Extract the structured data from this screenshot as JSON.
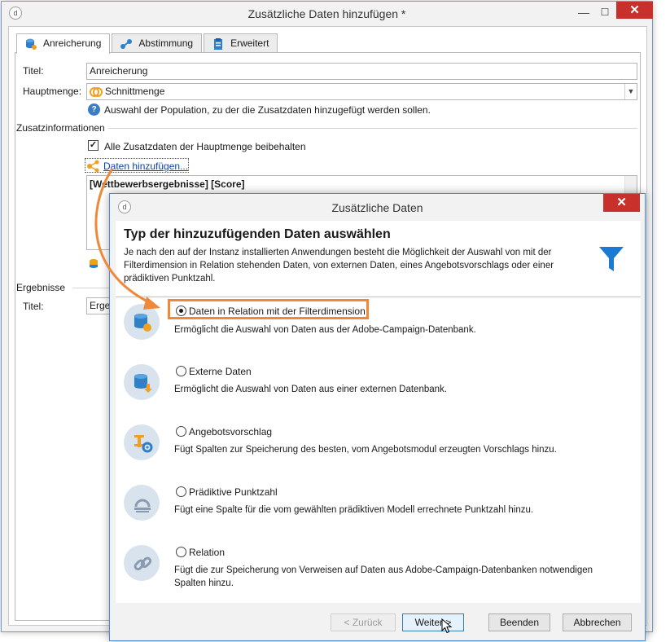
{
  "outer_window": {
    "title": "Zusätzliche Daten hinzufügen *",
    "tabs": [
      {
        "label": "Anreicherung",
        "icon": "database-enrich-icon"
      },
      {
        "label": "Abstimmung",
        "icon": "link-nodes-icon"
      },
      {
        "label": "Erweitert",
        "icon": "clipboard-icon"
      }
    ],
    "title_label": "Titel:",
    "title_value": "Anreicherung",
    "hauptmenge_label": "Hauptmenge:",
    "hauptmenge_value": "Schnittmenge",
    "help_text": "Auswahl der Population, zu der die Zusatzdaten hinzugefügt werden sollen.",
    "zusatz_group": "Zusatzinformationen",
    "keep_checkbox_label": "Alle Zusatzdaten der Hauptmenge beibehalten",
    "keep_checked": true,
    "add_data_link": "Daten hinzufügen...",
    "list_item": "[Wettbewerbsergebnisse] [Score]",
    "ergebnisse_group": "Ergebnisse",
    "result_title_label": "Titel:",
    "result_title_value": "Ergeb"
  },
  "dialog": {
    "title": "Zusätzliche Daten",
    "heading": "Typ der hinzuzufügenden Daten auswählen",
    "description": "Je nach den auf der Instanz installierten Anwendungen besteht die Möglichkeit der Auswahl von mit der Filterdimension in Relation stehenden Daten, von externen Daten, eines Angebotsvorschlags oder einer prädiktiven Punktzahl.",
    "options": [
      {
        "label": "Daten in Relation mit der Filterdimension",
        "desc": "Ermöglicht die Auswahl von Daten aus der Adobe-Campaign-Datenbank.",
        "selected": true,
        "icon": "database-filter-icon"
      },
      {
        "label": "Externe Daten",
        "desc": "Ermöglicht die Auswahl von Daten aus einer externen Datenbank.",
        "selected": false,
        "icon": "external-database-icon"
      },
      {
        "label": "Angebotsvorschlag",
        "desc": "Fügt Spalten zur Speicherung des besten, vom Angebotsmodul erzeugten Vorschlags hinzu.",
        "selected": false,
        "icon": "offer-gear-icon"
      },
      {
        "label": "Prädiktive Punktzahl",
        "desc": "Fügt eine Spalte für die vom gewählten prädiktiven Modell errechnete Punktzahl hinzu.",
        "selected": false,
        "icon": "predictive-score-icon"
      },
      {
        "label": "Relation",
        "desc": "Fügt die zur Speicherung von Verweisen auf Daten aus Adobe-Campaign-Datenbanken notwendigen Spalten hinzu.",
        "selected": false,
        "icon": "chain-link-icon"
      }
    ],
    "buttons": {
      "back": "< Zurück",
      "next": "Weiter >",
      "finish": "Beenden",
      "cancel": "Abbrechen"
    }
  },
  "colors": {
    "accent_orange": "#f0883a",
    "close_red": "#c7302b",
    "link_blue": "#0b3fb5",
    "funnel_blue": "#1b7bd3"
  }
}
